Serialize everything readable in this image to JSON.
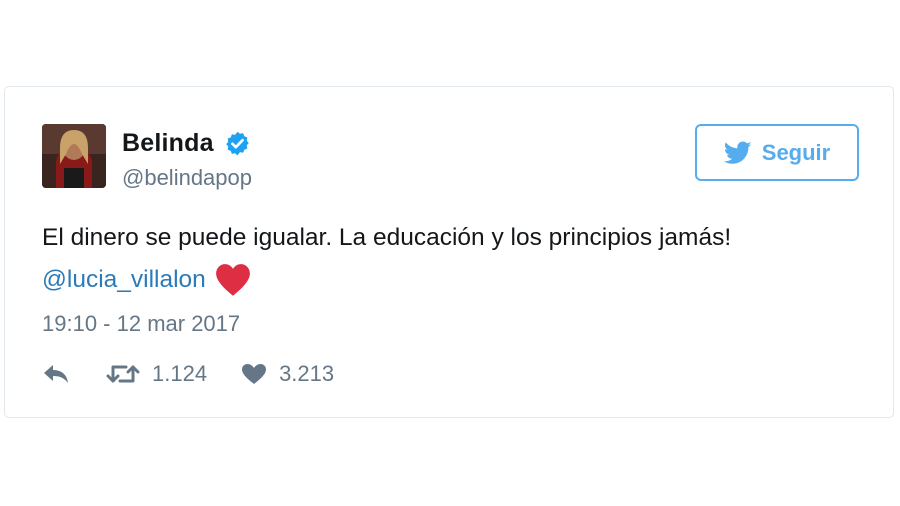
{
  "tweet": {
    "author": {
      "name": "Belinda",
      "handle": "@belindapop",
      "verified": true,
      "avatar_icon": "avatar-photo-icon"
    },
    "follow_button": {
      "label": "Seguir",
      "icon": "twitter-bird-icon"
    },
    "text": "El dinero se puede igualar. La educación y los principios jamás!",
    "mention": "@lucia_villalon",
    "emoji": "red-heart-emoji",
    "timestamp": "19:10 - 12 mar 2017",
    "actions": {
      "reply_icon": "reply-icon",
      "retweet_icon": "retweet-icon",
      "retweets": "1.124",
      "like_icon": "heart-icon",
      "likes": "3.213"
    }
  },
  "colors": {
    "text": "#14171a",
    "secondary": "#657786",
    "link": "#2b7bb9",
    "brand": "#55acee",
    "verified": "#1da1f2",
    "heart_emoji": "#dd2e44",
    "border": "#e1e8ed"
  }
}
